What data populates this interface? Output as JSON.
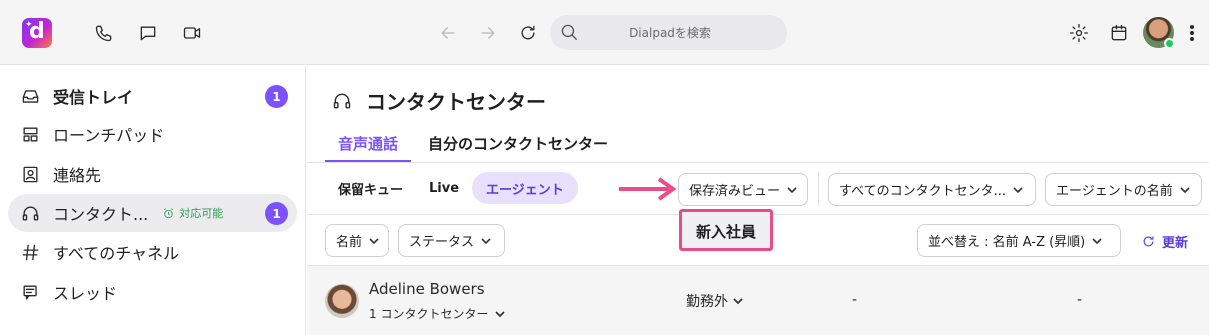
{
  "topbar": {
    "search_placeholder": "Dialpadを検索",
    "logo_letter": "d",
    "icons": [
      "phone-icon",
      "chat-icon",
      "video-icon",
      "back-arrow-icon",
      "forward-arrow-icon",
      "reload-icon",
      "settings-icon",
      "calendar-icon"
    ]
  },
  "sidebar": {
    "items": [
      {
        "label": "受信トレイ",
        "badge": "1",
        "icon": "inbox-icon"
      },
      {
        "label": "ローンチパッド",
        "icon": "launchpad-icon"
      },
      {
        "label": "連絡先",
        "icon": "contacts-icon"
      },
      {
        "label": "コンタクト...",
        "status": "対応可能",
        "badge": "1",
        "icon": "headset-icon"
      },
      {
        "label": "すべてのチャネル",
        "icon": "hash-icon"
      },
      {
        "label": "スレッド",
        "icon": "threads-icon"
      }
    ]
  },
  "main": {
    "title": "コンタクトセンター",
    "tabs": [
      {
        "label": "音声通話"
      },
      {
        "label": "自分のコンタクトセンター"
      }
    ],
    "subnav": [
      {
        "label": "保留キュー"
      },
      {
        "label": "Live"
      },
      {
        "label": "エージェント"
      }
    ],
    "filters": {
      "saved_view": "保存済みビュー",
      "all_centers": "すべてのコンタクトセンタ...",
      "agent_name": "エージェントの名前",
      "name": "名前",
      "status": "ステータス",
      "sort": "並べ替え : 名前 A-Z (昇順)",
      "refresh": "更新"
    },
    "tooltip": "新入社員",
    "rows": [
      {
        "name": "Adeline Bowers",
        "centers": "1 コンタクトセンター",
        "status": "勤務外",
        "col3": "-",
        "col4": "-"
      }
    ]
  },
  "colors": {
    "accent": "#7c52ff",
    "annotation": "#ea4c89",
    "available": "#2e9b53"
  }
}
